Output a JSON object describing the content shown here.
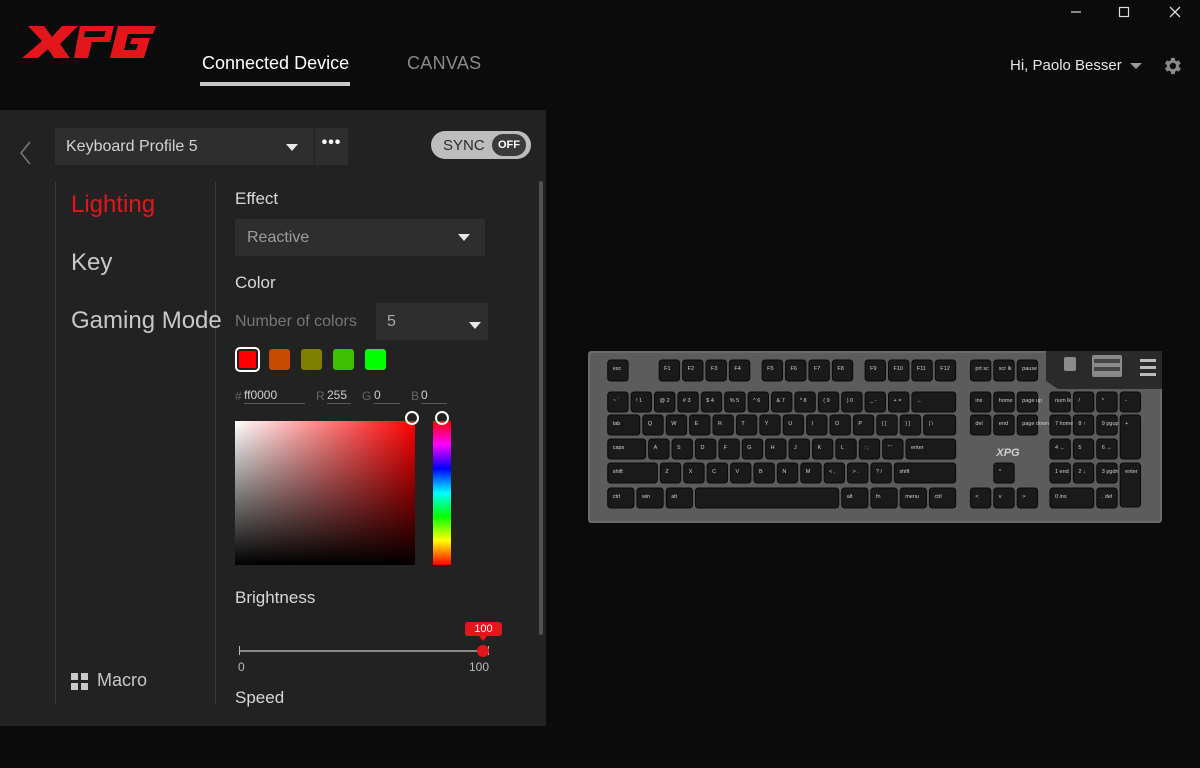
{
  "app": {
    "brand": "XPG",
    "colors": {
      "accent": "#e3161b",
      "panel": "#222222",
      "background": "#0b0b0b"
    }
  },
  "header": {
    "tabs": [
      {
        "label": "Connected Device",
        "active": true
      },
      {
        "label": "CANVAS",
        "active": false
      }
    ],
    "user_greeting": "Hi, Paolo Besser",
    "icons": [
      "minimize-icon",
      "maximize-icon",
      "close-icon",
      "gear-icon",
      "chevron-down-icon"
    ]
  },
  "toolbar": {
    "profile": "Keyboard Profile 5",
    "more_label": "•••",
    "sync_label": "SYNC",
    "sync_state": "OFF"
  },
  "sidebar": {
    "items": [
      {
        "label": "Lighting",
        "active": true
      },
      {
        "label": "Key",
        "active": false
      },
      {
        "label": "Gaming Mode",
        "active": false
      }
    ],
    "macro_label": "Macro"
  },
  "lighting": {
    "effect_title": "Effect",
    "effect_value": "Reactive",
    "color_title": "Color",
    "num_colors_label": "Number of colors",
    "num_colors_value": "5",
    "swatches": [
      "#ff0000",
      "#c64a00",
      "#7f7f00",
      "#3fbf00",
      "#00ff00"
    ],
    "hex_label": "#",
    "hex_value": "ff0000",
    "r_label": "R",
    "r_value": "255",
    "g_label": "G",
    "g_value": "0",
    "b_label": "B",
    "b_value": "0",
    "brightness_title": "Brightness",
    "brightness_value": "100",
    "brightness_min": "0",
    "brightness_max": "100",
    "speed_title": "Speed"
  },
  "keyboard": {
    "brand_mark": "XPG",
    "rows": [
      [
        "esc",
        "F1",
        "F2",
        "F3",
        "F4",
        "F5",
        "F6",
        "F7",
        "F8",
        "F9",
        "F10",
        "F11",
        "F12",
        "prt sc",
        "scr lk",
        "pause"
      ],
      [
        "~ `",
        "! 1",
        "@ 2",
        "# 3",
        "$ 4",
        "% 5",
        "^ 6",
        "& 7",
        "* 8",
        "( 9",
        ") 0",
        "_ -",
        "+ =",
        "←",
        "ins",
        "home",
        "page up",
        "num lk",
        "/",
        "*",
        "-"
      ],
      [
        "tab",
        "Q",
        "W",
        "E",
        "R",
        "T",
        "Y",
        "U",
        "I",
        "O",
        "P",
        "{ [",
        "} ]",
        "| \\",
        "del",
        "end",
        "page down",
        "7 home",
        "8 ↑",
        "9 pgup",
        "+"
      ],
      [
        "caps",
        "A",
        "S",
        "D",
        "F",
        "G",
        "H",
        "J",
        "K",
        "L",
        ": ;",
        "\" '",
        "enter",
        "4 ←",
        "5",
        "6 →"
      ],
      [
        "shift",
        "Z",
        "X",
        "C",
        "V",
        "B",
        "N",
        "M",
        "< ,",
        "> .",
        "? /",
        "shift",
        "^",
        "1 end",
        "2 ↓",
        "3 pgdn",
        "enter"
      ],
      [
        "ctrl",
        "win",
        "alt",
        "",
        "alt",
        "fn",
        "menu",
        "ctrl",
        "<",
        "v",
        ">",
        "0 ins",
        ". del"
      ]
    ]
  }
}
